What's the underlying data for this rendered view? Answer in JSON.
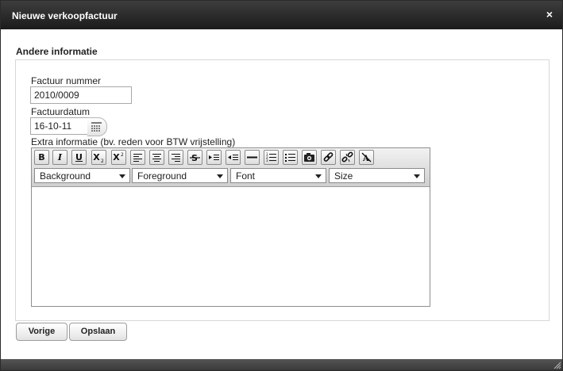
{
  "dialog": {
    "title": "Nieuwe verkoopfactuur",
    "close_label": "×"
  },
  "section": {
    "title": "Andere informatie"
  },
  "fields": {
    "invoice_number_label": "Factuur nummer",
    "invoice_number_value": "2010/0009",
    "invoice_date_label": "Factuurdatum",
    "invoice_date_value": "16-10-11",
    "extra_info_label": "Extra informatie (bv. reden voor BTW vrijstelling)"
  },
  "editor": {
    "bold_label": "B",
    "italic_label": "I",
    "underline_label": "U",
    "subscript_label": "X",
    "superscript_label": "X",
    "dropdowns": {
      "background": "Background",
      "foreground": "Foreground",
      "font": "Font",
      "size": "Size"
    },
    "content": ""
  },
  "buttons": {
    "previous": "Vorige",
    "save": "Opslaan"
  },
  "icons": {
    "calendar": "calendar-icon",
    "close": "close-icon",
    "resize": "resize-grip-icon"
  }
}
